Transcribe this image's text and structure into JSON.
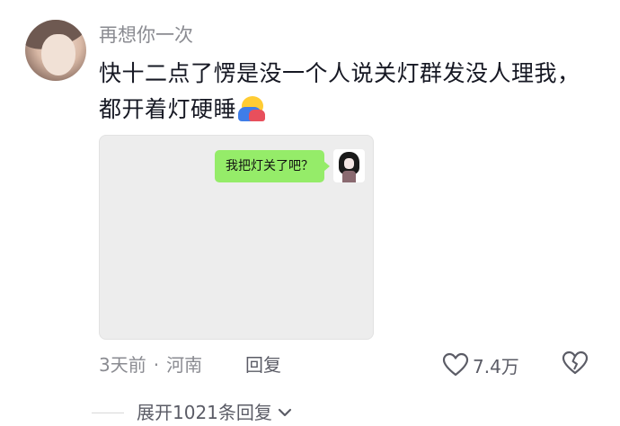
{
  "comment": {
    "username": "再想你一次",
    "text": "快十二点了愣是没一个人说关灯群发没人理我，都开着灯硬睡",
    "emoji": "hugging-emoji",
    "image": {
      "bubble_text": "我把灯关了吧？"
    },
    "time": "3天前",
    "separator": "·",
    "location": "河南",
    "reply_label": "回复",
    "like_count": "7.4万",
    "expand_label": "展开1021条回复"
  },
  "colors": {
    "bubble": "#95ec69",
    "meta_text": "#8a8b91",
    "primary_text": "#161823"
  }
}
